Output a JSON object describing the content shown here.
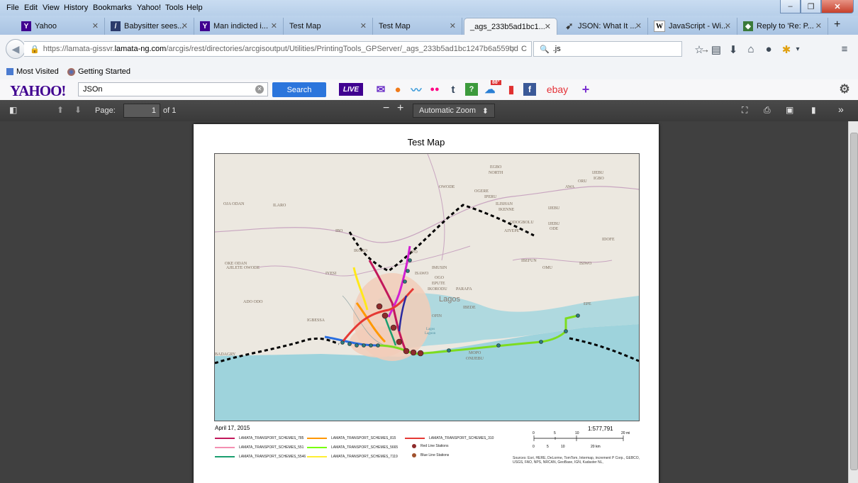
{
  "menu": [
    "File",
    "Edit",
    "View",
    "History",
    "Bookmarks",
    "Yahoo!",
    "Tools",
    "Help"
  ],
  "tabs": [
    {
      "label": "Yahoo",
      "icon": "yahoo-icon"
    },
    {
      "label": "Babysitter sees...",
      "icon": "news-icon"
    },
    {
      "label": "Man indicted i...",
      "icon": "yahoo-icon"
    },
    {
      "label": "Test Map",
      "icon": ""
    },
    {
      "label": "Test Map",
      "icon": ""
    },
    {
      "label": "_ags_233b5ad1bc1...",
      "icon": ""
    },
    {
      "label": "JSON: What It ...",
      "icon": "json-icon"
    },
    {
      "label": "JavaScript - Wi...",
      "icon": "wikipedia-icon"
    },
    {
      "label": "Reply to 'Re: P...",
      "icon": "forum-icon"
    }
  ],
  "nav": {
    "url_prefix": "https://lamata-gissvr.",
    "url_domain": "lamata-ng.com",
    "url_rest": "/arcgis/rest/directories/arcgisoutput/Utilities/PrintingTools_GPServer/_ags_233b5ad1bc1247b6a559bd",
    "search_value": ".js"
  },
  "bookmarks": {
    "most_visited": "Most Visited",
    "getting_started": "Getting Started"
  },
  "yahoo": {
    "logo": "YAHOO!",
    "search_value": "JSOn",
    "search_button": "Search",
    "live": "LIVE",
    "weather": "88°",
    "ebay": "ebay"
  },
  "pdf": {
    "page_label": "Page:",
    "page_value": "1",
    "page_of": "of 1",
    "zoom": "Automatic Zoom"
  },
  "map": {
    "title": "Test Map",
    "date": "April 17, 2015",
    "scale": "1:577,791",
    "scale_mi": [
      "0",
      "5",
      "10",
      "20 mi"
    ],
    "scale_km": [
      "0",
      "5",
      "10",
      "20 km"
    ],
    "sources": "Sources: Esri, HERE, DeLorme, TomTom, Intermap, increment P Corp., GEBCO, USGS, FAO, NPS, NRCAN, GeoBase, IGN, Kadaster NL,",
    "places": [
      "EGBO",
      "NORTH",
      "OWODE",
      "OGERE",
      "IPERU",
      "ILISHAN",
      "IKENNE",
      "IJEBU",
      "IGBO",
      "AWA",
      "ORU",
      "OJA ODAN",
      "ILARO",
      "IBO",
      "ODOGBOLU",
      "IJEBU ODE",
      "AIYEPE",
      "IDOFE",
      "IKORO",
      "IFO",
      "OKE ODAN",
      "AJILETE OWODE",
      "IYESI",
      "ISAWO",
      "IMUSIN",
      "OGO",
      "EPUTE",
      "IKORODU",
      "PARAFA",
      "Lagos",
      "IBEFUN",
      "OMU",
      "ISIWO",
      "ADO ODO",
      "IGBESSA",
      "OFIN",
      "IBEDE",
      "EPE",
      "BADAGRY",
      "MOPO",
      "ONIJEBU",
      "Lagos Lagoon"
    ],
    "legend": [
      {
        "label": "LAMATA_TRANSPORT_SCHEMES_785",
        "color": "#c2185b",
        "kind": "line"
      },
      {
        "label": "LAMATA_TRANSPORT_SCHEMES_815",
        "color": "#ff9800",
        "kind": "line"
      },
      {
        "label": "LAMATA_TRANSPORT_SCHEMES_310",
        "color": "#e53935",
        "kind": "line"
      },
      {
        "label": "LAMATA_TRANSPORT_SCHEMES_551",
        "color": "#f48fb1",
        "kind": "line"
      },
      {
        "label": "LAMATA_TRANSPORT_SCHEMES_5665",
        "color": "#76ff03",
        "kind": "line"
      },
      {
        "label": "Red Line Stations",
        "color": "#8e2b2b",
        "kind": "dot"
      },
      {
        "label": "LAMATA_TRANSPORT_SCHEMES_5546",
        "color": "#1b9e6f",
        "kind": "line"
      },
      {
        "label": "LAMATA_TRANSPORT_SCHEMES_7119",
        "color": "#ffee33",
        "kind": "line"
      },
      {
        "label": "Blue Line Stations",
        "color": "#a0522d",
        "kind": "dot"
      }
    ]
  }
}
